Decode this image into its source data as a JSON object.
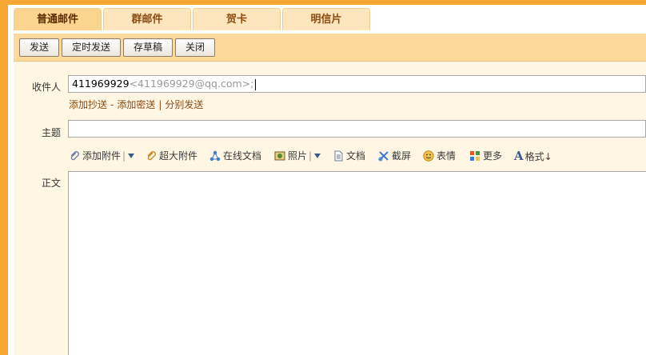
{
  "tabs": [
    {
      "label": "普通邮件",
      "active": true
    },
    {
      "label": "群邮件",
      "active": false
    },
    {
      "label": "贺卡",
      "active": false
    },
    {
      "label": "明信片",
      "active": false
    }
  ],
  "toolbar": {
    "send_label": "发送",
    "scheduled_send_label": "定时发送",
    "save_draft_label": "存草稿",
    "close_label": "关闭"
  },
  "compose": {
    "recipient_label": "收件人",
    "recipient_name": "411969929",
    "recipient_address": "<411969929@qq.com>;",
    "add_cc_label": "添加抄送",
    "add_cc_sep": "-",
    "add_bcc_label": "添加密送",
    "split_sep": "|",
    "separate_send_label": "分别发送",
    "subject_label": "主题",
    "subject_value": "",
    "body_label": "正文",
    "body_value": ""
  },
  "attach_toolbar": {
    "add_attachment_label": "添加附件",
    "large_attachment_label": "超大附件",
    "online_doc_label": "在线文档",
    "photo_label": "照片",
    "doc_label": "文档",
    "screenshot_label": "截屏",
    "emoji_label": "表情",
    "more_label": "更多",
    "format_label": "格式↓"
  },
  "colors": {
    "frame_orange": "#f7a833",
    "toolbar_bg": "#fdd99b",
    "panel_bg": "#fff6e3",
    "link_brown": "#8a4b12"
  }
}
